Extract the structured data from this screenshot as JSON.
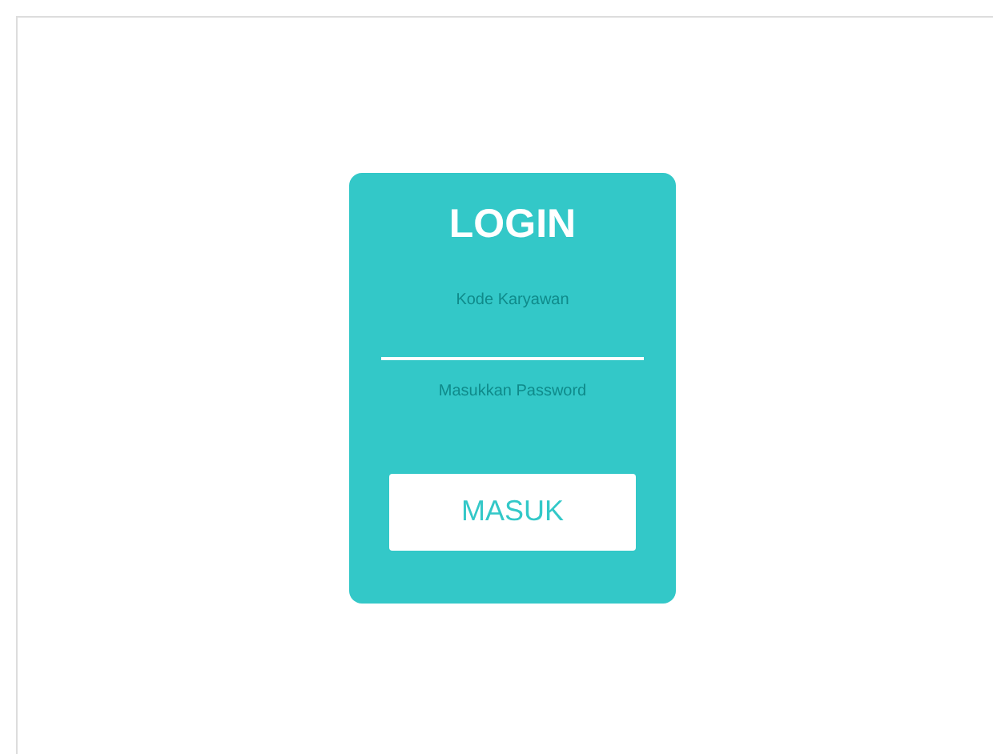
{
  "login_card": {
    "title": "LOGIN",
    "fields": [
      {
        "placeholder": "Kode Karyawan"
      },
      {
        "placeholder": "Masukkan Password"
      }
    ],
    "button": "MASUK"
  }
}
